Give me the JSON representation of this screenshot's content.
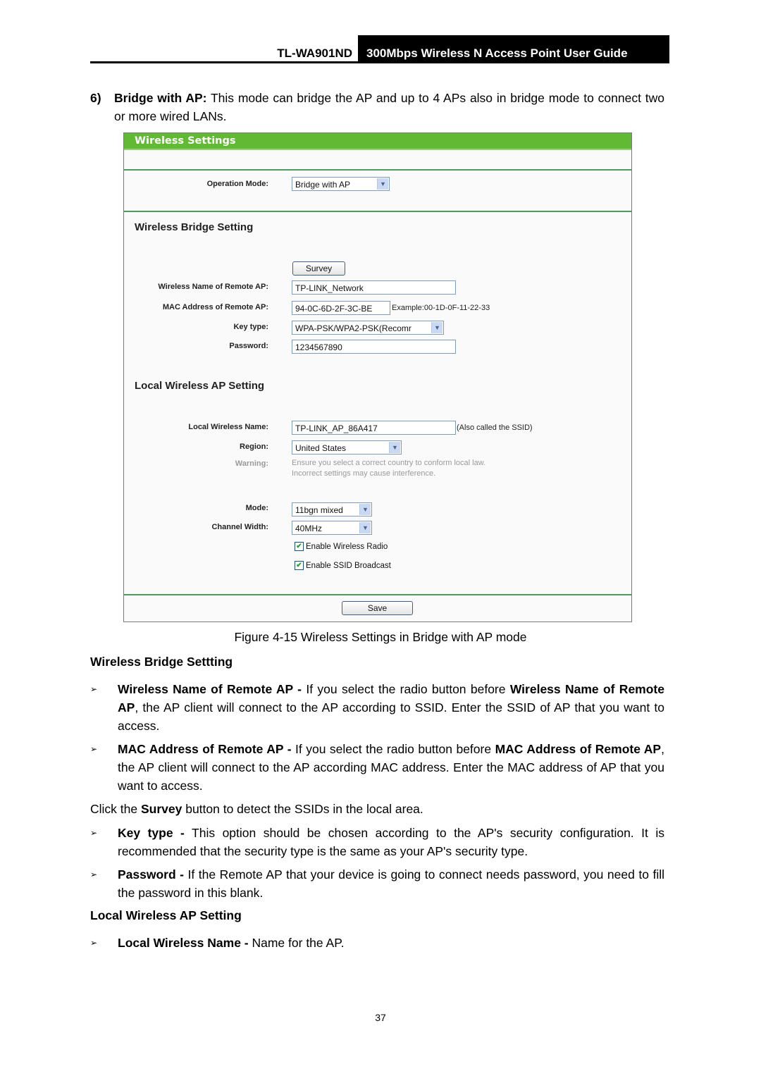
{
  "header": {
    "model": "TL-WA901ND",
    "title": "300Mbps Wireless N Access Point User Guide"
  },
  "intro": {
    "number": "6)",
    "bold": "Bridge with AP:",
    "text": " This mode can bridge the AP and up to 4 APs also in bridge mode to connect two or more wired LANs."
  },
  "figure": {
    "panel_title": "Wireless Settings",
    "operation_mode": {
      "label": "Operation Mode:",
      "value": "Bridge with AP"
    },
    "bridge_section": {
      "title": "Wireless Bridge Setting",
      "survey_button": "Survey",
      "remote_name": {
        "label": "Wireless Name of Remote AP:",
        "value": "TP-LINK_Network"
      },
      "remote_mac": {
        "label": "MAC Address of Remote AP:",
        "value": "94-0C-6D-2F-3C-BE",
        "hint": "Example:00-1D-0F-11-22-33"
      },
      "key_type": {
        "label": "Key type:",
        "value": "WPA-PSK/WPA2-PSK(Recomr"
      },
      "password": {
        "label": "Password:",
        "value": "1234567890"
      }
    },
    "local_section": {
      "title": "Local Wireless AP Setting",
      "local_name": {
        "label": "Local Wireless Name:",
        "value": "TP-LINK_AP_86A417",
        "hint": "(Also called the SSID)"
      },
      "region": {
        "label": "Region:",
        "value": "United States"
      },
      "warning": {
        "label": "Warning:",
        "line1": "Ensure you select a correct country to conform local law.",
        "line2": "Incorrect settings may cause interference."
      },
      "mode": {
        "label": "Mode:",
        "value": "11bgn mixed"
      },
      "channel_width": {
        "label": "Channel Width:",
        "value": "40MHz"
      },
      "enable_radio": {
        "label": "Enable Wireless Radio",
        "checked": true
      },
      "enable_ssid": {
        "label": "Enable SSID Broadcast",
        "checked": true
      }
    },
    "save_button": "Save",
    "caption": "Figure 4-15 Wireless Settings in Bridge with AP mode"
  },
  "sections": {
    "bridge_heading": "Wireless Bridge Settting",
    "bullet1": {
      "b1": "Wireless Name of Remote AP -",
      "t1": " If you select the radio button before ",
      "b2": "Wireless Name of Remote AP",
      "t2": ", the AP client will connect to the AP according to SSID. Enter the SSID of AP that you want to access."
    },
    "bullet2": {
      "b1": "MAC Address of Remote AP -",
      "t1": " If you select the radio button before ",
      "b2": "MAC Address of Remote AP",
      "t2": ", the AP client will connect to the AP according MAC address. Enter the MAC address of AP that you want to access."
    },
    "survey_para": {
      "t1": "Click the ",
      "b1": "Survey",
      "t2": " button to detect the SSIDs in the local area."
    },
    "bullet3": {
      "b1": "Key type -",
      "t1": " This option should be chosen according to the AP's security configuration. It is recommended that the security type is the same as your AP's security type."
    },
    "bullet4": {
      "b1": "Password -",
      "t1": " If the Remote AP that your device is going to connect needs password, you need to fill the password in this blank."
    },
    "local_heading": "Local Wireless AP Setting",
    "bullet5": {
      "b1": "Local Wireless Name -",
      "t1": " Name for the AP."
    },
    "bullet_glyph": "➢"
  },
  "page_number": "37"
}
